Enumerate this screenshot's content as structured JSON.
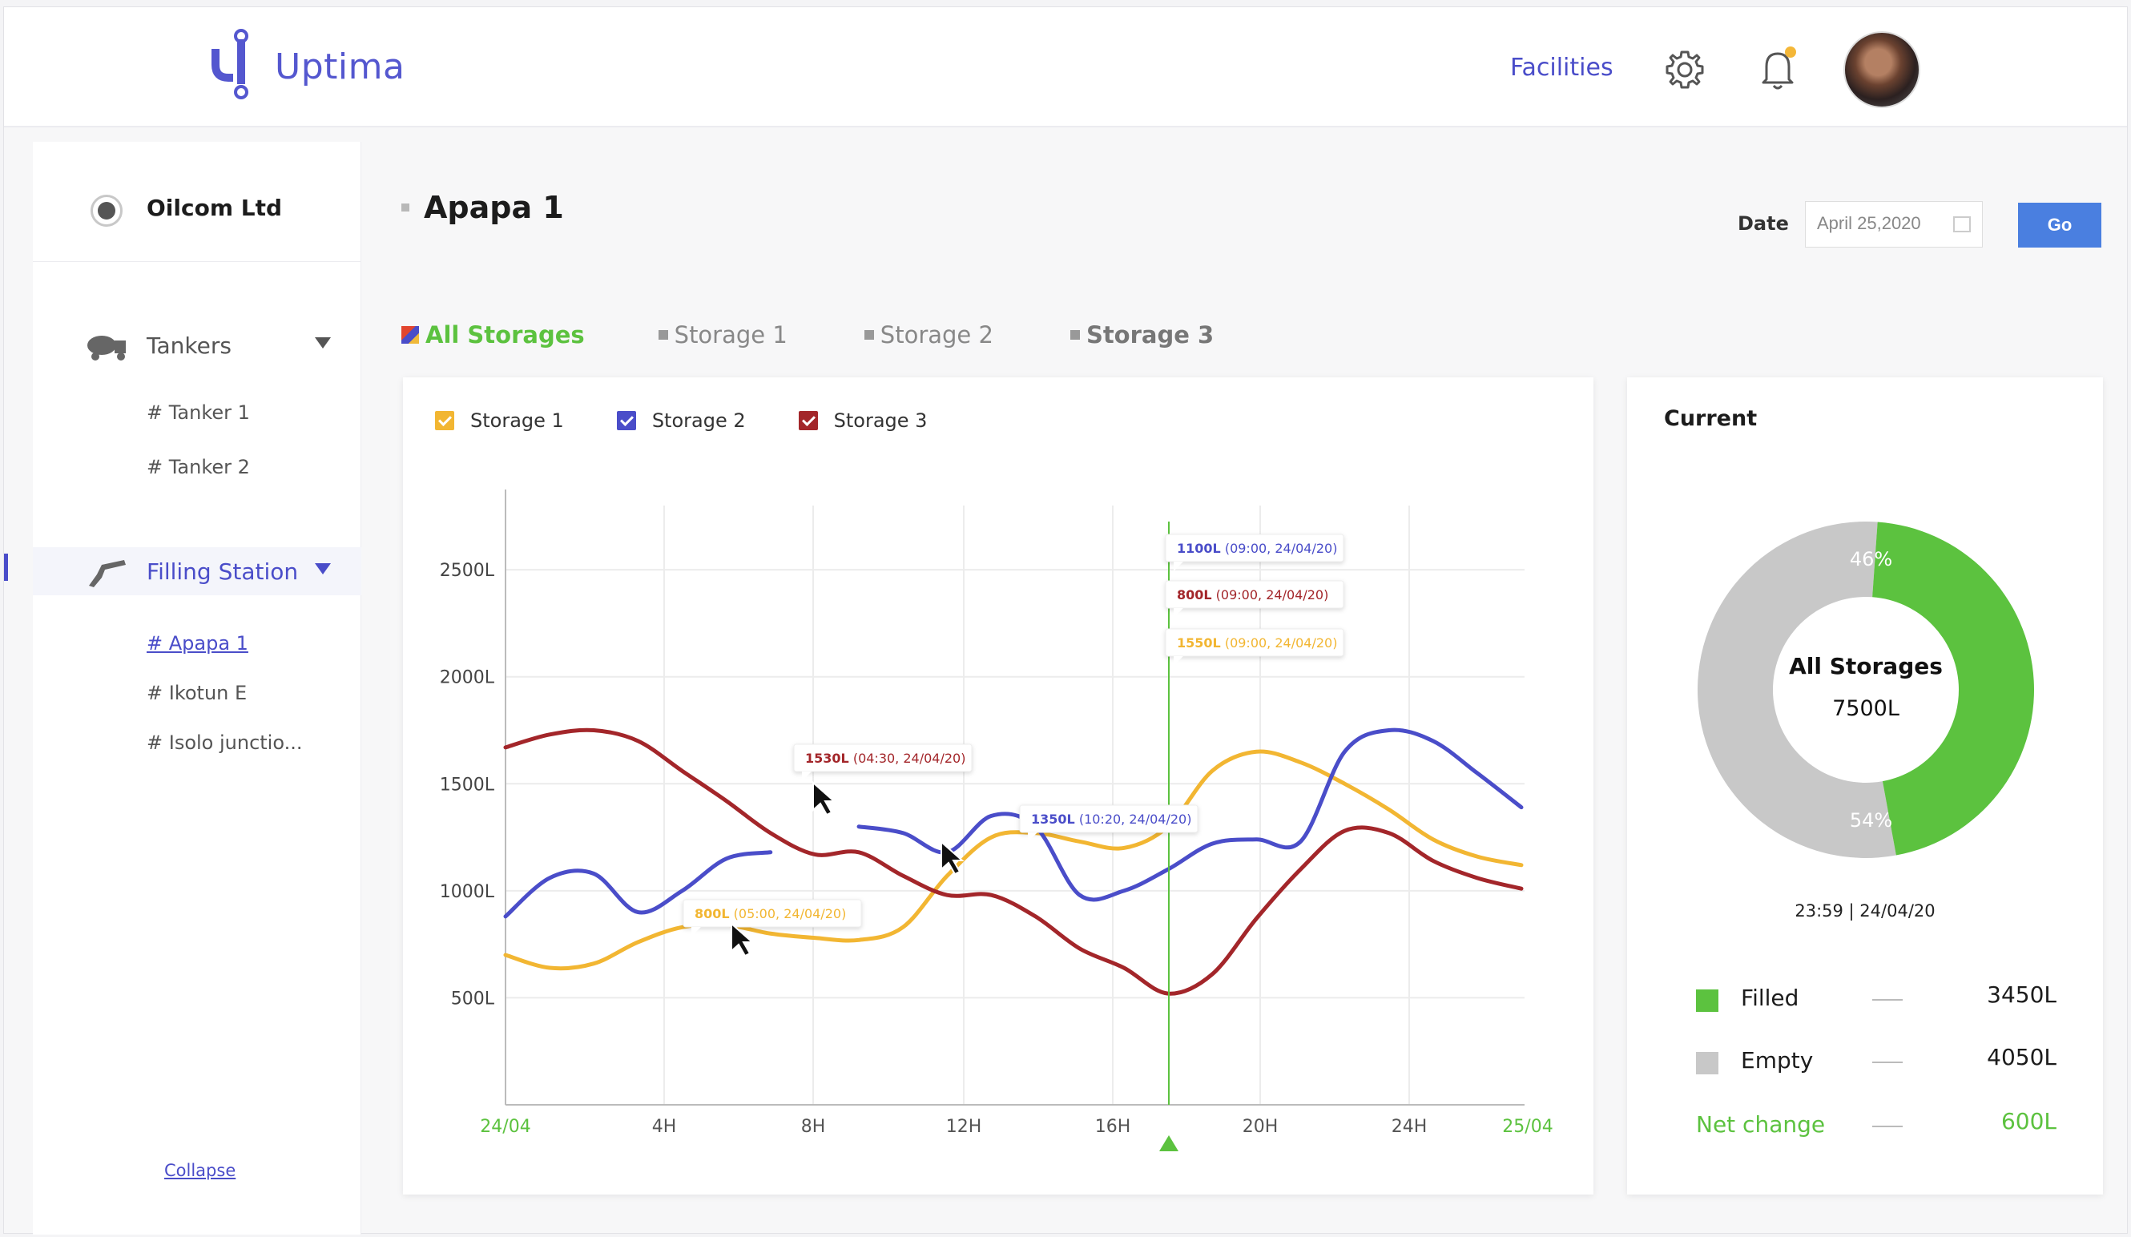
{
  "app": {
    "name": "Uptima",
    "brand_color": "#5457cf"
  },
  "header": {
    "nav_facilities": "Facilities",
    "icons": [
      "gear-icon",
      "bell-icon"
    ],
    "bell_badge_color": "#f4b738"
  },
  "sidebar": {
    "company": "Oilcom Ltd",
    "groups": [
      {
        "label": "Tankers",
        "icon": "tanker-icon",
        "items": [
          "# Tanker 1",
          "# Tanker 2"
        ]
      },
      {
        "label": "Filling Station",
        "icon": "fuel-nozzle-icon",
        "items": [
          "# Apapa 1",
          "# Ikotun E",
          "# Isolo junctio..."
        ],
        "active_item": "# Apapa 1"
      }
    ],
    "collapse": "Collapse"
  },
  "main": {
    "title": "Apapa 1",
    "date_label": "Date",
    "date_value": "April 25,2020",
    "go_label": "Go",
    "tabs": [
      "All Storages",
      "Storage 1",
      "Storage 2",
      "Storage 3"
    ],
    "active_tab": "All Storages"
  },
  "chart_data": {
    "type": "line",
    "legend_placement": "top-left",
    "grid": true,
    "series": [
      {
        "name": "Storage 1",
        "color": "#f2b632",
        "values": [
          700,
          640,
          660,
          760,
          830,
          840,
          800,
          780,
          770,
          830,
          1070,
          1250,
          1270,
          1230,
          1200,
          1300,
          1560,
          1650,
          1600,
          1500,
          1380,
          1240,
          1160,
          1120
        ]
      },
      {
        "name": "Storage 2",
        "color": "#4a4dc9",
        "values": [
          880,
          1060,
          1080,
          900,
          1000,
          1150,
          1180,
          null,
          1300,
          1270,
          1180,
          1350,
          1300,
          980,
          1000,
          1100,
          1220,
          1240,
          1230,
          1650,
          1750,
          1700,
          1550,
          1390
        ]
      },
      {
        "name": "Storage 3",
        "color": "#a3262a",
        "values": [
          1670,
          1730,
          1750,
          1700,
          1560,
          1420,
          1270,
          1170,
          1180,
          1070,
          980,
          980,
          880,
          730,
          640,
          520,
          610,
          870,
          1100,
          1280,
          1270,
          1140,
          1060,
          1010
        ]
      }
    ],
    "x_ticks": [
      "24/04",
      "4H",
      "8H",
      "12H",
      "16H",
      "20H",
      "24H",
      "25/04"
    ],
    "y_ticks": [
      "500L",
      "1000L",
      "1500L",
      "2000L",
      "2500L"
    ],
    "ylim": [
      0,
      2800
    ],
    "marker_hour": 16.5,
    "tooltips": [
      {
        "value": "1530L",
        "time": "(04:30, 24/04/20)",
        "color": "#a3262a"
      },
      {
        "value": "1350L",
        "time": "(10:20, 24/04/20)",
        "color": "#4a4dc9"
      },
      {
        "value": "800L",
        "time": "(05:00, 24/04/20)",
        "color": "#f2b632"
      },
      {
        "value": "1100L",
        "time": "(09:00, 24/04/20)",
        "color": "#4a4dc9"
      },
      {
        "value": "800L",
        "time": "(09:00, 24/04/20)",
        "color": "#a3262a"
      },
      {
        "value": "1550L",
        "time": "(09:00, 24/04/20)",
        "color": "#f2b632"
      }
    ]
  },
  "current": {
    "title": "Current",
    "donut": {
      "center_title": "All Storages",
      "center_value": "7500L",
      "filled_pct": 46,
      "empty_pct": 54,
      "filled_label": "46%",
      "empty_label": "54%"
    },
    "timestamp": "23:59 | 24/04/20",
    "filled": {
      "label": "Filled",
      "value": "3450L",
      "color": "#5cc23f"
    },
    "empty": {
      "label": "Empty",
      "value": "4050L",
      "color": "#c8c8c8"
    },
    "net_change": {
      "label": "Net change",
      "value": "600L"
    }
  }
}
